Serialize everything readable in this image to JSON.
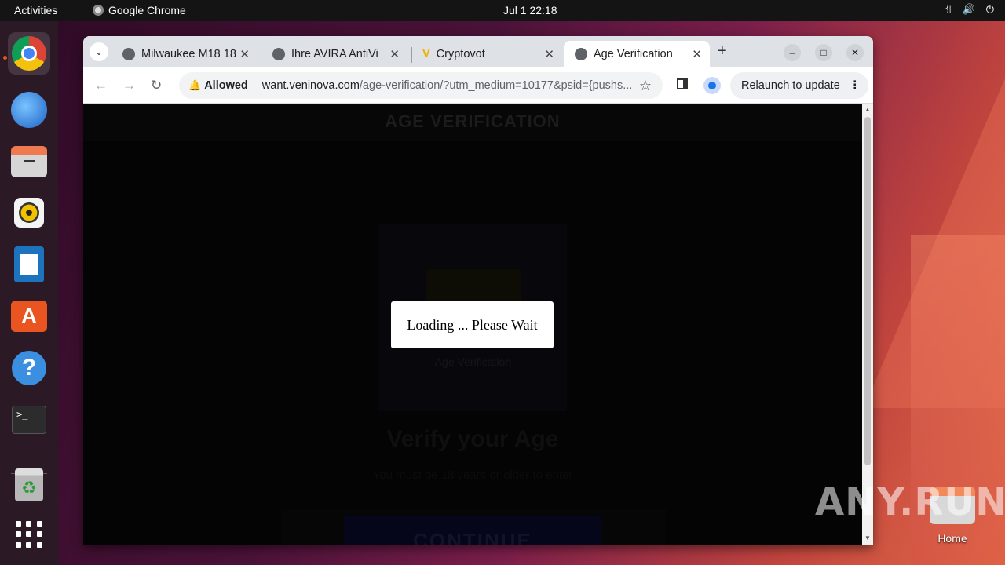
{
  "topbar": {
    "activities": "Activities",
    "app_name": "Google Chrome",
    "clock": "Jul 1  22:18",
    "tray": {
      "network_icon": "network-icon",
      "volume_icon": "volume-icon",
      "power_icon": "power-icon"
    }
  },
  "dock": {
    "items": [
      {
        "name": "chrome",
        "icon": "chrome-icon",
        "running": true
      },
      {
        "name": "thunderbird",
        "icon": "thunderbird-icon"
      },
      {
        "name": "files",
        "icon": "files-icon"
      },
      {
        "name": "rhythmbox",
        "icon": "rhythmbox-icon"
      },
      {
        "name": "writer",
        "icon": "writer-icon"
      },
      {
        "name": "software",
        "icon": "software-store-icon"
      },
      {
        "name": "help",
        "icon": "help-icon",
        "glyph": "?"
      },
      {
        "name": "terminal",
        "icon": "terminal-icon",
        "glyph": ">_"
      },
      {
        "name": "trash",
        "icon": "trash-icon"
      },
      {
        "name": "show-apps",
        "icon": "apps-grid-icon"
      }
    ]
  },
  "desktop": {
    "home_label": "Home",
    "watermark": "ANY.RUN"
  },
  "browser": {
    "tabs": [
      {
        "title": "Milwaukee M18 18",
        "active": false
      },
      {
        "title": "Ihre AVIRA AntiVi",
        "active": false
      },
      {
        "title": "Cryptovot",
        "active": false,
        "favicon": "V"
      },
      {
        "title": "Age Verification",
        "active": true
      }
    ],
    "new_tab": "+",
    "window_controls": {
      "minimize": "–",
      "maximize": "□",
      "close": "✕"
    },
    "omnibox": {
      "permission": "Allowed",
      "domain": "want.veninova.com",
      "path": "/age-verification/?utm_medium=10177&psid={pushs..."
    },
    "relaunch_label": "Relaunch to update"
  },
  "page": {
    "header": "AGE VERIFICATION",
    "card_caption": "Age Verification",
    "verify_title": "Verify your Age",
    "verify_sub": "You must be 18 years or older to enter",
    "continue_label": "CONTINUE",
    "loading_text": "Loading ... Please Wait"
  }
}
